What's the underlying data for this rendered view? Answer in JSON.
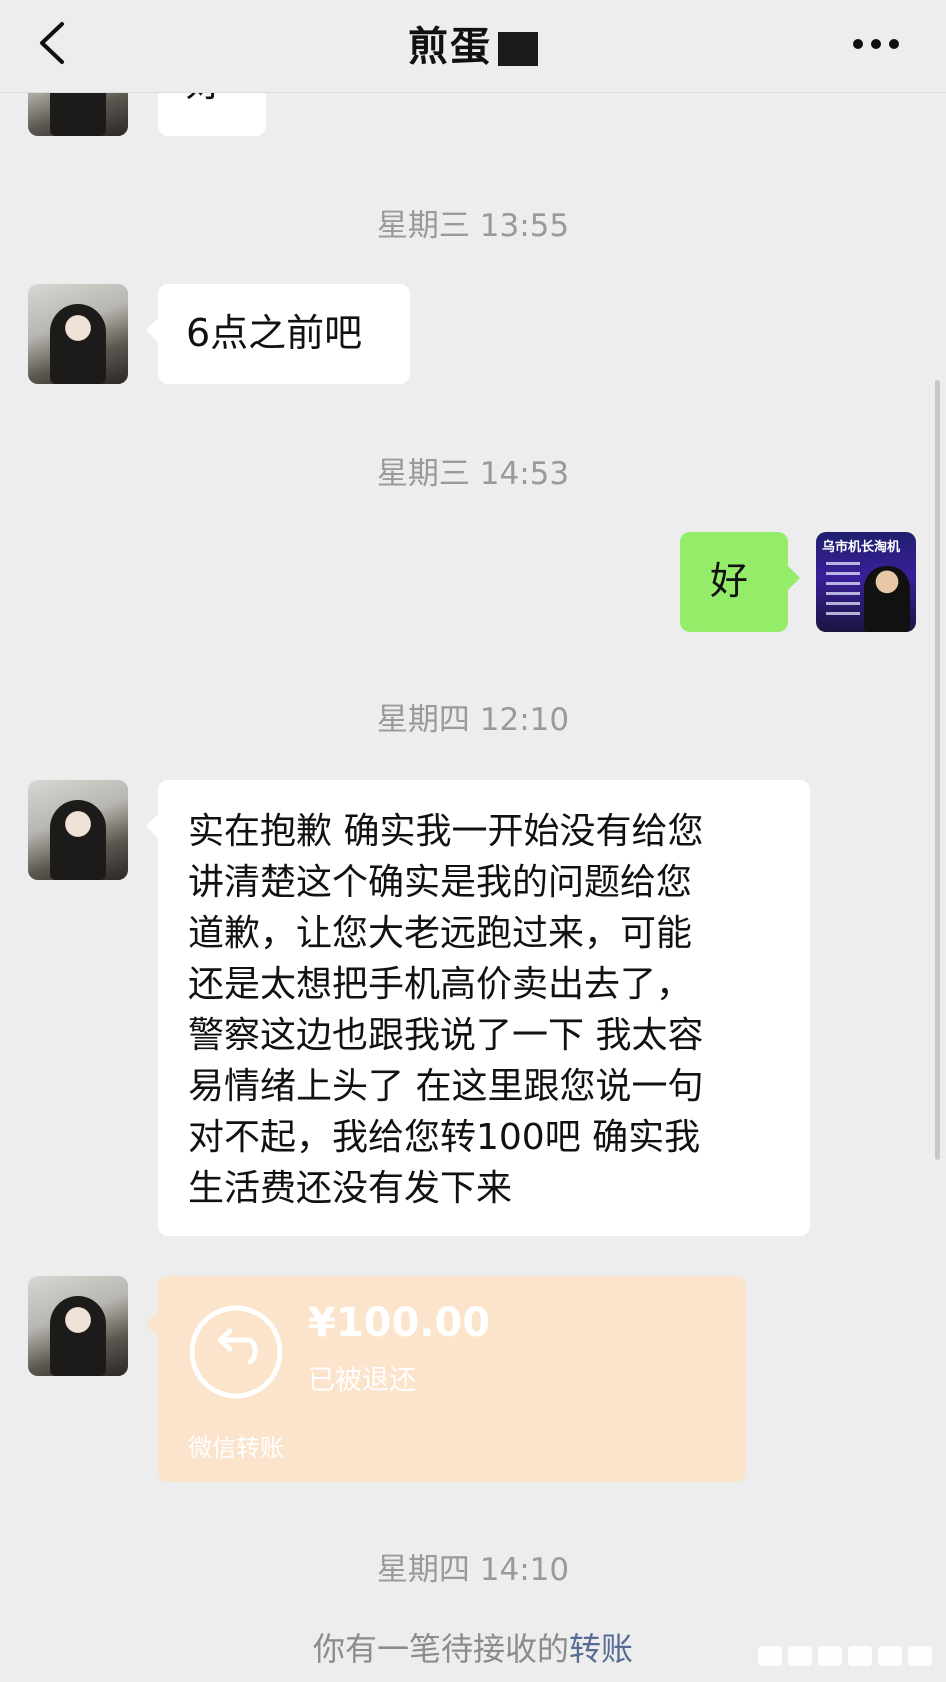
{
  "header": {
    "title": "煎蛋",
    "back_icon": "chevron-left-icon",
    "more_icon": "more-horizontal-icon"
  },
  "messages": {
    "top_partial": "好",
    "time_1": "星期三 13:55",
    "msg_1": "6点之前吧",
    "time_2": "星期三 14:53",
    "msg_2": "好",
    "time_3": "星期四 12:10",
    "msg_3_lines": [
      "实在抱歉 确实我一开始没有给您",
      "讲清楚这个确实是我的问题给您",
      "道歉，让您大老远跑过来，可能",
      "还是太想把手机高价卖出去了，",
      "警察这边也跟我说了一下  我太容",
      "易情绪上头了  在这里跟您说一句",
      "对不起，我给您转100吧 确实我",
      "生活费还没有发下来"
    ],
    "transfer": {
      "amount": "¥100.00",
      "status": "已被退还",
      "brand": "微信转账",
      "icon": "refund-icon"
    },
    "time_4": "星期四 14:10",
    "notice_text": "你有一笔待接收的",
    "notice_link": "转账"
  },
  "avatars": {
    "self_logo": "乌市机长淘机"
  },
  "colors": {
    "background": "#ededed",
    "peer_bubble": "#ffffff",
    "self_bubble": "#95ec69",
    "transfer_bg": "#fbe4cb",
    "link": "#576b95"
  }
}
